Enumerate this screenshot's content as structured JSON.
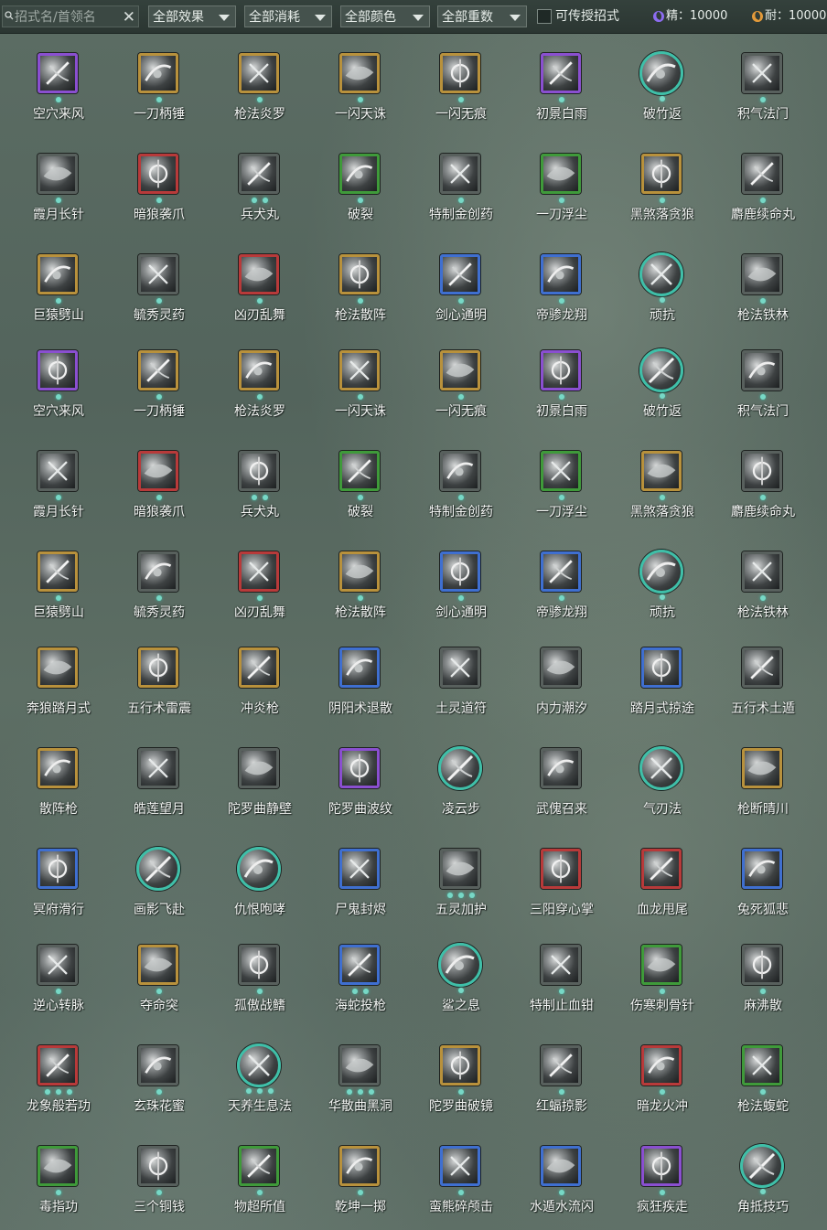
{
  "toolbar": {
    "search_placeholder": "招式名/首领名",
    "clear_glyph": "✕",
    "filters": [
      {
        "label": "全部效果"
      },
      {
        "label": "全部消耗"
      },
      {
        "label": "全部颜色"
      },
      {
        "label": "全部重数"
      }
    ],
    "checkbox_label": "可传授招式",
    "checkbox_checked": false,
    "resources": [
      {
        "text": "精：10000",
        "color": "#8c6cf0"
      },
      {
        "text": "耐：10000",
        "color": "#e39a3a"
      }
    ]
  },
  "skills": [
    {
      "name": "空穴来风",
      "frame": "purple",
      "shape": "square",
      "dots": 1
    },
    {
      "name": "一刀柄锤",
      "frame": "gold",
      "shape": "square",
      "dots": 1
    },
    {
      "name": "枪法炎罗",
      "frame": "gold",
      "shape": "square",
      "dots": 1
    },
    {
      "name": "一闪天诛",
      "frame": "gold",
      "shape": "square",
      "dots": 1
    },
    {
      "name": "一闪无痕",
      "frame": "gold",
      "shape": "square",
      "dots": 1
    },
    {
      "name": "初景白雨",
      "frame": "purple",
      "shape": "square",
      "dots": 1
    },
    {
      "name": "破竹返",
      "frame": "teal",
      "shape": "circle",
      "dots": 1
    },
    {
      "name": "积气法门",
      "frame": "gray",
      "shape": "square",
      "dots": 1
    },
    {
      "name": "霞月长针",
      "frame": "gray",
      "shape": "square",
      "dots": 1
    },
    {
      "name": "暗狼袭爪",
      "frame": "red",
      "shape": "square",
      "dots": 1
    },
    {
      "name": "兵犬丸",
      "frame": "gray",
      "shape": "square",
      "dots": 2
    },
    {
      "name": "破裂",
      "frame": "green",
      "shape": "square",
      "dots": 1
    },
    {
      "name": "特制金创药",
      "frame": "gray",
      "shape": "square",
      "dots": 1
    },
    {
      "name": "一刀浮尘",
      "frame": "green",
      "shape": "square",
      "dots": 1
    },
    {
      "name": "黑煞落贪狼",
      "frame": "gold",
      "shape": "square",
      "dots": 1
    },
    {
      "name": "麝鹿续命丸",
      "frame": "gray",
      "shape": "square",
      "dots": 1
    },
    {
      "name": "巨猿劈山",
      "frame": "gold",
      "shape": "square",
      "dots": 1
    },
    {
      "name": "毓秀灵药",
      "frame": "gray",
      "shape": "square",
      "dots": 1
    },
    {
      "name": "凶刃乱舞",
      "frame": "red",
      "shape": "square",
      "dots": 1
    },
    {
      "name": "枪法散阵",
      "frame": "gold",
      "shape": "square",
      "dots": 1
    },
    {
      "name": "剑心通明",
      "frame": "blue",
      "shape": "square",
      "dots": 1
    },
    {
      "name": "帝骖龙翔",
      "frame": "blue",
      "shape": "square",
      "dots": 1
    },
    {
      "name": "顽抗",
      "frame": "teal",
      "shape": "circle",
      "dots": 1
    },
    {
      "name": "枪法铁林",
      "frame": "gray",
      "shape": "square",
      "dots": 1
    },
    {
      "name": "空穴来风",
      "frame": "purple",
      "shape": "square",
      "dots": 1
    },
    {
      "name": "一刀柄锤",
      "frame": "gold",
      "shape": "square",
      "dots": 1
    },
    {
      "name": "枪法炎罗",
      "frame": "gold",
      "shape": "square",
      "dots": 1
    },
    {
      "name": "一闪天诛",
      "frame": "gold",
      "shape": "square",
      "dots": 1
    },
    {
      "name": "一闪无痕",
      "frame": "gold",
      "shape": "square",
      "dots": 1
    },
    {
      "name": "初景白雨",
      "frame": "purple",
      "shape": "square",
      "dots": 1
    },
    {
      "name": "破竹返",
      "frame": "teal",
      "shape": "circle",
      "dots": 1
    },
    {
      "name": "积气法门",
      "frame": "gray",
      "shape": "square",
      "dots": 1
    },
    {
      "name": "霞月长针",
      "frame": "gray",
      "shape": "square",
      "dots": 1
    },
    {
      "name": "暗狼袭爪",
      "frame": "red",
      "shape": "square",
      "dots": 1
    },
    {
      "name": "兵犬丸",
      "frame": "gray",
      "shape": "square",
      "dots": 2
    },
    {
      "name": "破裂",
      "frame": "green",
      "shape": "square",
      "dots": 1
    },
    {
      "name": "特制金创药",
      "frame": "gray",
      "shape": "square",
      "dots": 1
    },
    {
      "name": "一刀浮尘",
      "frame": "green",
      "shape": "square",
      "dots": 1
    },
    {
      "name": "黑煞落贪狼",
      "frame": "gold",
      "shape": "square",
      "dots": 1
    },
    {
      "name": "麝鹿续命丸",
      "frame": "gray",
      "shape": "square",
      "dots": 1
    },
    {
      "name": "巨猿劈山",
      "frame": "gold",
      "shape": "square",
      "dots": 1
    },
    {
      "name": "毓秀灵药",
      "frame": "gray",
      "shape": "square",
      "dots": 1
    },
    {
      "name": "凶刃乱舞",
      "frame": "red",
      "shape": "square",
      "dots": 1
    },
    {
      "name": "枪法散阵",
      "frame": "gold",
      "shape": "square",
      "dots": 1
    },
    {
      "name": "剑心通明",
      "frame": "blue",
      "shape": "square",
      "dots": 1
    },
    {
      "name": "帝骖龙翔",
      "frame": "blue",
      "shape": "square",
      "dots": 1
    },
    {
      "name": "顽抗",
      "frame": "teal",
      "shape": "circle",
      "dots": 1
    },
    {
      "name": "枪法铁林",
      "frame": "gray",
      "shape": "square",
      "dots": 1
    },
    {
      "name": "奔狼踏月式",
      "frame": "gold",
      "shape": "square",
      "dots": 0
    },
    {
      "name": "五行术雷震",
      "frame": "gold",
      "shape": "square",
      "dots": 0
    },
    {
      "name": "冲炎枪",
      "frame": "gold",
      "shape": "square",
      "dots": 0
    },
    {
      "name": "阴阳术退散",
      "frame": "blue",
      "shape": "square",
      "dots": 0
    },
    {
      "name": "土灵道符",
      "frame": "gray",
      "shape": "square",
      "dots": 0
    },
    {
      "name": "内力潮汐",
      "frame": "gray",
      "shape": "square",
      "dots": 0
    },
    {
      "name": "踏月式掠途",
      "frame": "blue",
      "shape": "square",
      "dots": 0
    },
    {
      "name": "五行术土遁",
      "frame": "gray",
      "shape": "square",
      "dots": 0
    },
    {
      "name": "散阵枪",
      "frame": "gold",
      "shape": "square",
      "dots": 0
    },
    {
      "name": "皓莲望月",
      "frame": "gray",
      "shape": "square",
      "dots": 0
    },
    {
      "name": "陀罗曲静壁",
      "frame": "gray",
      "shape": "square",
      "dots": 0
    },
    {
      "name": "陀罗曲波纹",
      "frame": "purple",
      "shape": "square",
      "dots": 0
    },
    {
      "name": "凌云步",
      "frame": "teal",
      "shape": "circle",
      "dots": 0
    },
    {
      "name": "武傀召来",
      "frame": "gray",
      "shape": "square",
      "dots": 0
    },
    {
      "name": "气刃法",
      "frame": "teal",
      "shape": "circle",
      "dots": 0
    },
    {
      "name": "枪断晴川",
      "frame": "gold",
      "shape": "square",
      "dots": 0
    },
    {
      "name": "冥府滑行",
      "frame": "blue",
      "shape": "square",
      "dots": 0
    },
    {
      "name": "画影飞赴",
      "frame": "teal",
      "shape": "circle",
      "dots": 0
    },
    {
      "name": "仇恨咆哮",
      "frame": "teal",
      "shape": "circle",
      "dots": 0
    },
    {
      "name": "尸鬼封烬",
      "frame": "blue",
      "shape": "square",
      "dots": 0
    },
    {
      "name": "五灵加护",
      "frame": "gray",
      "shape": "square",
      "dots": 3
    },
    {
      "name": "三阳穿心掌",
      "frame": "red",
      "shape": "square",
      "dots": 0
    },
    {
      "name": "血龙甩尾",
      "frame": "red",
      "shape": "square",
      "dots": 0
    },
    {
      "name": "兔死狐悲",
      "frame": "blue",
      "shape": "square",
      "dots": 0
    },
    {
      "name": "逆心转脉",
      "frame": "gray",
      "shape": "square",
      "dots": 1
    },
    {
      "name": "夺命突",
      "frame": "gold",
      "shape": "square",
      "dots": 1
    },
    {
      "name": "孤傲战鳍",
      "frame": "gray",
      "shape": "square",
      "dots": 1
    },
    {
      "name": "海蛇投枪",
      "frame": "blue",
      "shape": "square",
      "dots": 2
    },
    {
      "name": "鲨之息",
      "frame": "teal",
      "shape": "circle",
      "dots": 1
    },
    {
      "name": "特制止血钳",
      "frame": "gray",
      "shape": "square",
      "dots": 1
    },
    {
      "name": "伤寒刺骨针",
      "frame": "green",
      "shape": "square",
      "dots": 1
    },
    {
      "name": "麻沸散",
      "frame": "gray",
      "shape": "square",
      "dots": 1
    },
    {
      "name": "龙象般若功",
      "frame": "red",
      "shape": "square",
      "dots": 3
    },
    {
      "name": "玄珠花蜜",
      "frame": "gray",
      "shape": "square",
      "dots": 1
    },
    {
      "name": "天养生息法",
      "frame": "teal",
      "shape": "circle",
      "dots": 3
    },
    {
      "name": "华散曲黑洞",
      "frame": "gray",
      "shape": "square",
      "dots": 3
    },
    {
      "name": "陀罗曲破镜",
      "frame": "gold",
      "shape": "square",
      "dots": 1
    },
    {
      "name": "红蝠掠影",
      "frame": "gray",
      "shape": "square",
      "dots": 1
    },
    {
      "name": "暗龙火冲",
      "frame": "red",
      "shape": "square",
      "dots": 1
    },
    {
      "name": "枪法蝮蛇",
      "frame": "green",
      "shape": "square",
      "dots": 1
    },
    {
      "name": "毒指功",
      "frame": "green",
      "shape": "square",
      "dots": 1
    },
    {
      "name": "三个铜钱",
      "frame": "gray",
      "shape": "square",
      "dots": 1
    },
    {
      "name": "物超所值",
      "frame": "green",
      "shape": "square",
      "dots": 1
    },
    {
      "name": "乾坤一掷",
      "frame": "gold",
      "shape": "square",
      "dots": 1
    },
    {
      "name": "蛮熊碎颅击",
      "frame": "blue",
      "shape": "square",
      "dots": 1
    },
    {
      "name": "水遁水流闪",
      "frame": "blue",
      "shape": "square",
      "dots": 1
    },
    {
      "name": "疯狂疾走",
      "frame": "purple",
      "shape": "square",
      "dots": 1
    },
    {
      "name": "角抵技巧",
      "frame": "teal",
      "shape": "circle",
      "dots": 1
    }
  ]
}
